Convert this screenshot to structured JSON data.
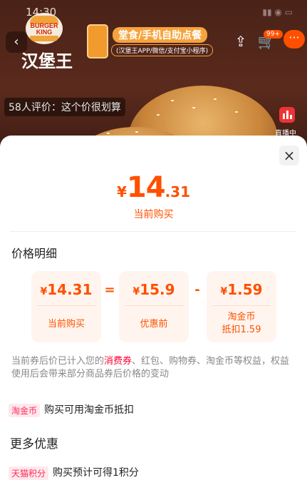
{
  "status_bar": {
    "time": "14:30"
  },
  "background": {
    "brand_logo_text": "BURGER KING",
    "brand_name_cn": "汉堡王",
    "promo_title": "堂食/手机自助点餐",
    "promo_sub": "(汉堡王APP/微信/支付宝小程序)",
    "cart_badge": "99+",
    "review_text": "58人评价：这个价很划算",
    "live_label": "直播中",
    "icons": [
      "back-icon",
      "share-icon",
      "cart-icon",
      "more-icon",
      "live-icon"
    ]
  },
  "sheet": {
    "close_icon": "×",
    "hero": {
      "currency": "¥",
      "integer": "14",
      "decimal": ".31",
      "label": "当前购买"
    },
    "detail_title": "价格明细",
    "cards": [
      {
        "value": "14.31",
        "label": "当前购买"
      },
      {
        "value": "15.9",
        "label": "优惠前"
      },
      {
        "value": "1.59",
        "label": "淘金币\n抵扣1.59"
      }
    ],
    "operators": [
      "=",
      "-"
    ],
    "note_prefix": "当前券后价已计入您的",
    "note_highlight": "消费券",
    "note_suffix": "、红包、购物券、淘金币等权益，权益使用后会带来部分商品券后价格的变动",
    "coin_row": {
      "tag": "淘金币",
      "text": "购买可用淘金币抵扣"
    },
    "more_title": "更多优惠",
    "tmall_row": {
      "tag": "天猫积分",
      "text": "购买预计可得1积分"
    }
  },
  "colors": {
    "accent": "#ff5000",
    "tag_red": "#ff2a55",
    "card_bg": "#fff5ee"
  }
}
